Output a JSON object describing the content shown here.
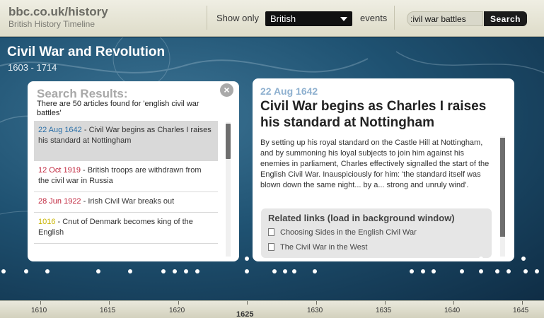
{
  "header": {
    "site_title": "bbc.co.uk/history",
    "site_subtitle": "British History Timeline",
    "show_only_label": "Show only",
    "filter_selected": "British",
    "events_label": "events",
    "search_value": ":ivil war battles",
    "search_button": "Search"
  },
  "period": {
    "title": "Civil War and Revolution",
    "range": "1603 - 1714"
  },
  "results": {
    "title": "Search Results:",
    "close_label": "×",
    "count_text": "There are 50 articles found for 'english civil war battles'",
    "items": [
      {
        "date": "22 Aug 1642",
        "text": " - Civil War begins as Charles I raises his standard at Nottingham",
        "color": "#2a6fa8"
      },
      {
        "date": "12 Oct 1919",
        "text": " - British troops are withdrawn from the civil war in Russia",
        "color": "#c0263d"
      },
      {
        "date": "28 Jun 1922",
        "text": " - Irish Civil War breaks out",
        "color": "#c0263d"
      },
      {
        "date": "1016",
        "text": " - Cnut of Denmark becomes king of the English",
        "color": "#c9b400"
      }
    ]
  },
  "article": {
    "date": "22 Aug 1642",
    "title": "Civil War begins as Charles I raises his standard at Nottingham",
    "body": "By setting up his royal standard on the Castle Hill at Nottingham, and by summoning his loyal subjects to join him against his enemies in parliament, Charles effectively signalled the start of the English Civil War. Inauspiciously for him: 'the standard itself was blown down the same night... by a... strong and unruly wind'.",
    "related_title": "Related links (load in background window)",
    "links": [
      "Choosing Sides in the English Civil War",
      "The Civil War in the West"
    ]
  },
  "timeline": {
    "years": [
      "1610",
      "1615",
      "1620",
      "1625",
      "1630",
      "1635",
      "1640",
      "1645"
    ],
    "current_year": "1625"
  },
  "colors": {
    "accent_blue": "#8eb0cf",
    "header_bg": "#e6e5d6"
  }
}
